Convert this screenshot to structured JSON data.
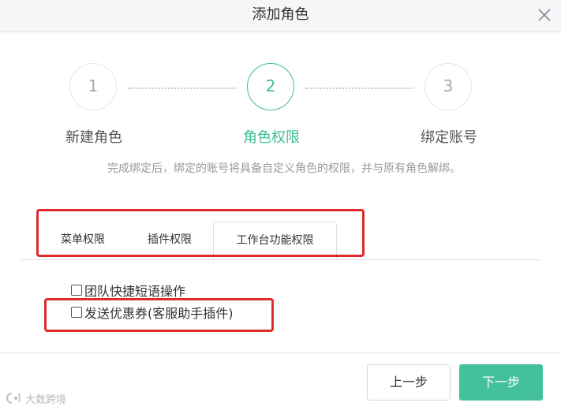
{
  "dialog": {
    "title": "添加角色",
    "close_icon": "close-icon"
  },
  "steps": [
    {
      "number": "1",
      "label": "新建角色",
      "state": "done"
    },
    {
      "number": "2",
      "label": "角色权限",
      "state": "active"
    },
    {
      "number": "3",
      "label": "绑定账号",
      "state": "pending"
    }
  ],
  "description": "完成绑定后，绑定的账号将具备自定义角色的权限，并与原有角色解绑。",
  "tabs": [
    {
      "label": "菜单权限"
    },
    {
      "label": "插件权限"
    },
    {
      "label": "工作台功能权限",
      "active": true
    }
  ],
  "permissions": [
    {
      "label": "团队快捷短语操作",
      "checked": false
    },
    {
      "label": "发送优惠券(客服助手插件)",
      "checked": false
    }
  ],
  "buttons": {
    "prev_label": "上一步",
    "next_label": "下一步"
  },
  "watermark": {
    "text": "大数跨境"
  },
  "colors": {
    "accent": "#3dbd97",
    "highlight": "#e02a2a"
  }
}
